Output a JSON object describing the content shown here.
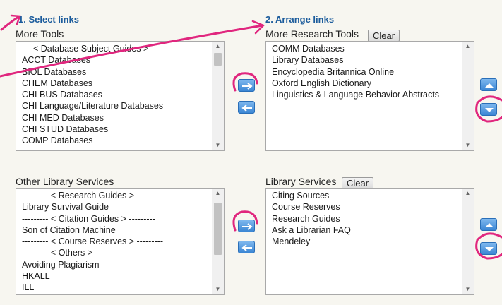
{
  "steps": {
    "select": "1. Select links",
    "arrange": "2. Arrange links"
  },
  "top": {
    "source_label": "More Tools",
    "source_items": [
      "--- < Database Subject Guides > ---",
      "ACCT Databases",
      "BIOL Databases",
      "CHEM Databases",
      "CHI BUS Databases",
      "CHI Language/Literature Databases",
      "CHI MED Databases",
      "CHI STUD Databases",
      "COMP Databases"
    ],
    "target_label": "More Research Tools",
    "target_items": [
      "COMM Databases",
      "Library Databases",
      "Encyclopedia Britannica Online",
      "Oxford English Dictionary",
      "Linguistics & Language Behavior Abstracts"
    ]
  },
  "bottom": {
    "source_label": "Other Library Services",
    "source_items": [
      "--------- < Research Guides > ---------",
      "Library Survival Guide",
      "--------- < Citation Guides > ---------",
      "Son of Citation Machine",
      "--------- < Course Reserves > ---------",
      "--------- < Others > ---------",
      "Avoiding Plagiarism",
      "HKALL",
      "ILL"
    ],
    "target_label": "Library Services",
    "target_items": [
      "Citing Sources",
      "Course Reserves",
      "Research Guides",
      "Ask a Librarian FAQ",
      "Mendeley"
    ]
  },
  "clear_label": "Clear",
  "colors": {
    "accent": "#1c5c9c",
    "annotation": "#e0267e",
    "button_blue": "#3b86d4"
  },
  "icons": {
    "add": "arrow-right-icon",
    "remove": "arrow-left-icon",
    "move_up": "triangle-up-icon",
    "move_down": "triangle-down-icon"
  }
}
